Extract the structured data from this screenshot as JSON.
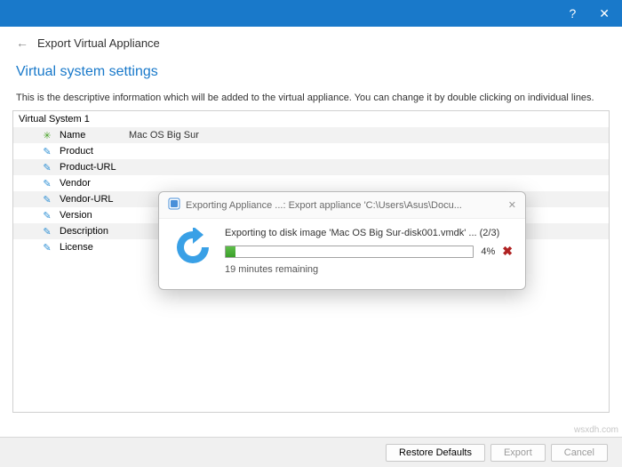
{
  "titlebar": {
    "help": "?",
    "close": "✕"
  },
  "header": {
    "back": "←",
    "title": "Export Virtual Appliance"
  },
  "section_title": "Virtual system settings",
  "helptext": "This is the descriptive information which will be added to the virtual appliance. You can change it by double clicking on individual lines.",
  "group_label": "Virtual System 1",
  "rows": [
    {
      "icon": "gear",
      "label": "Name",
      "value": "Mac OS Big Sur"
    },
    {
      "icon": "tag",
      "label": "Product",
      "value": ""
    },
    {
      "icon": "tag",
      "label": "Product-URL",
      "value": ""
    },
    {
      "icon": "tag",
      "label": "Vendor",
      "value": ""
    },
    {
      "icon": "tag",
      "label": "Vendor-URL",
      "value": ""
    },
    {
      "icon": "tag",
      "label": "Version",
      "value": ""
    },
    {
      "icon": "tag",
      "label": "Description",
      "value": ""
    },
    {
      "icon": "tag",
      "label": "License",
      "value": ""
    }
  ],
  "footer": {
    "restore": "Restore Defaults",
    "export": "Export",
    "cancel": "Cancel"
  },
  "modal": {
    "title": "Exporting Appliance ...: Export appliance 'C:\\Users\\Asus\\Docu...",
    "status": "Exporting to disk image 'Mac OS Big Sur-disk001.vmdk' ... (2/3)",
    "percent_label": "4%",
    "percent_value": 4,
    "remaining": "19 minutes remaining"
  },
  "watermark": "wsxdh.com"
}
